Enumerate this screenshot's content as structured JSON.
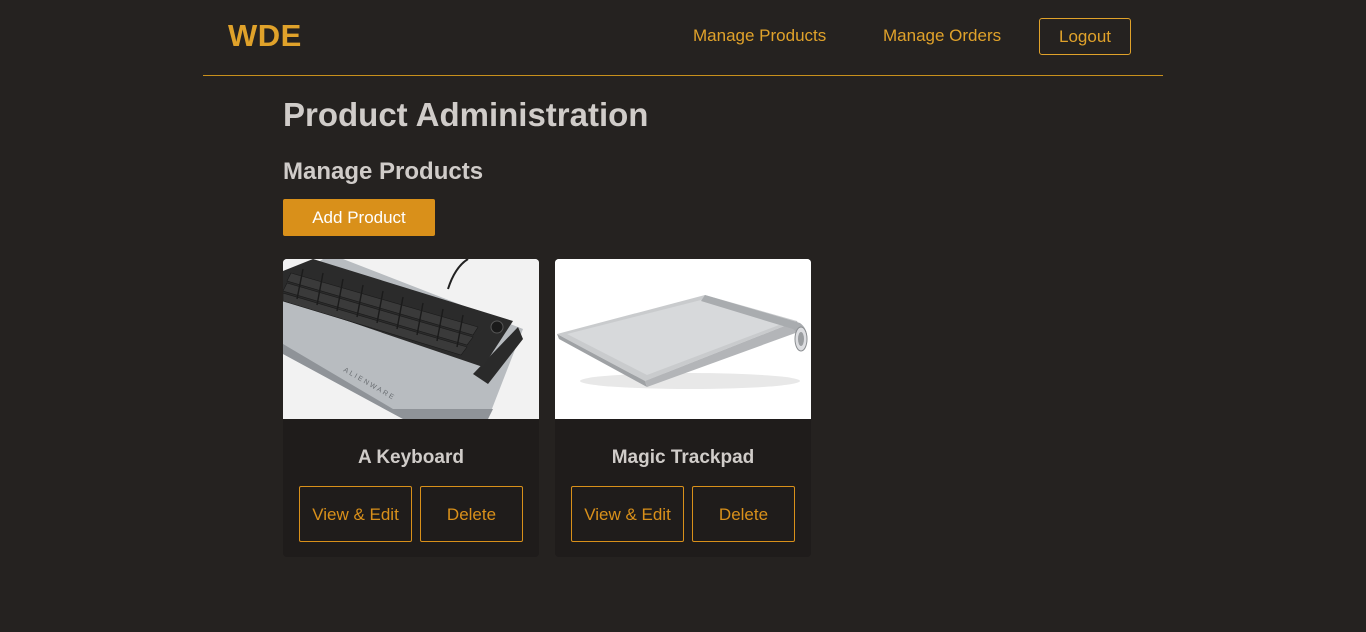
{
  "header": {
    "logo": "WDE",
    "nav": {
      "manage_products": "Manage Products",
      "manage_orders": "Manage Orders",
      "logout": "Logout"
    }
  },
  "main": {
    "title": "Product Administration",
    "section_title": "Manage Products",
    "add_button": "Add Product",
    "products": [
      {
        "name": "A Keyboard",
        "image": "keyboard-image",
        "edit_label": "View & Edit",
        "delete_label": "Delete"
      },
      {
        "name": "Magic Trackpad",
        "image": "trackpad-image",
        "edit_label": "View & Edit",
        "delete_label": "Delete"
      }
    ]
  },
  "colors": {
    "background": "#252220",
    "accent": "#e0a22a",
    "button": "#d9901a",
    "card": "#1f1c1b",
    "text": "#d0ccc9"
  }
}
